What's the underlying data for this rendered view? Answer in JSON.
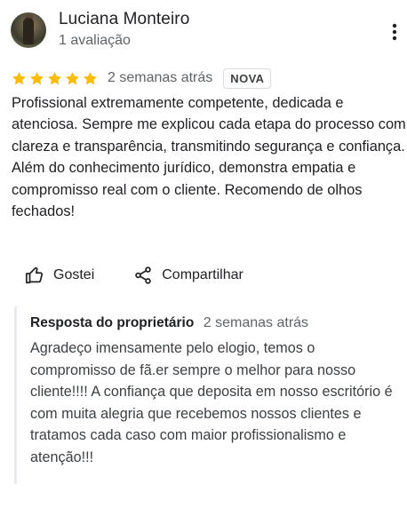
{
  "reviewer": {
    "name": "Luciana Monteiro",
    "meta": "1 avaliação",
    "avatar_icon": "user-photo"
  },
  "rating": {
    "stars": 5,
    "max": 5,
    "star_color": "#fbbc04",
    "date": "2 semanas atrás",
    "badge": "NOVA"
  },
  "review": {
    "text": "Profissional extremamente competente, dedicada e atenciosa. Sempre me explicou cada etapa do processo com clareza e transparência, transmitindo segurança e confiança. Além do conhecimento jurídico, demonstra empatia e compromisso real com o cliente. Recomendo de olhos fechados!"
  },
  "actions": {
    "like_label": "Gostei",
    "like_icon": "thumbs-up-icon",
    "share_label": "Compartilhar",
    "share_icon": "share-icon",
    "more_icon": "more-vert-icon"
  },
  "owner_response": {
    "label": "Resposta do proprietário",
    "date": "2 semanas atrás",
    "text": "Agradeço imensamente pelo elogio, temos o compromisso de fã.er sempre o melhor para nosso cliente!!!! A confiança que deposita em nosso escritório é com muita alegria que recebemos nossos clientes e tratamos cada caso com maior profissionalismo e atenção!!!"
  }
}
